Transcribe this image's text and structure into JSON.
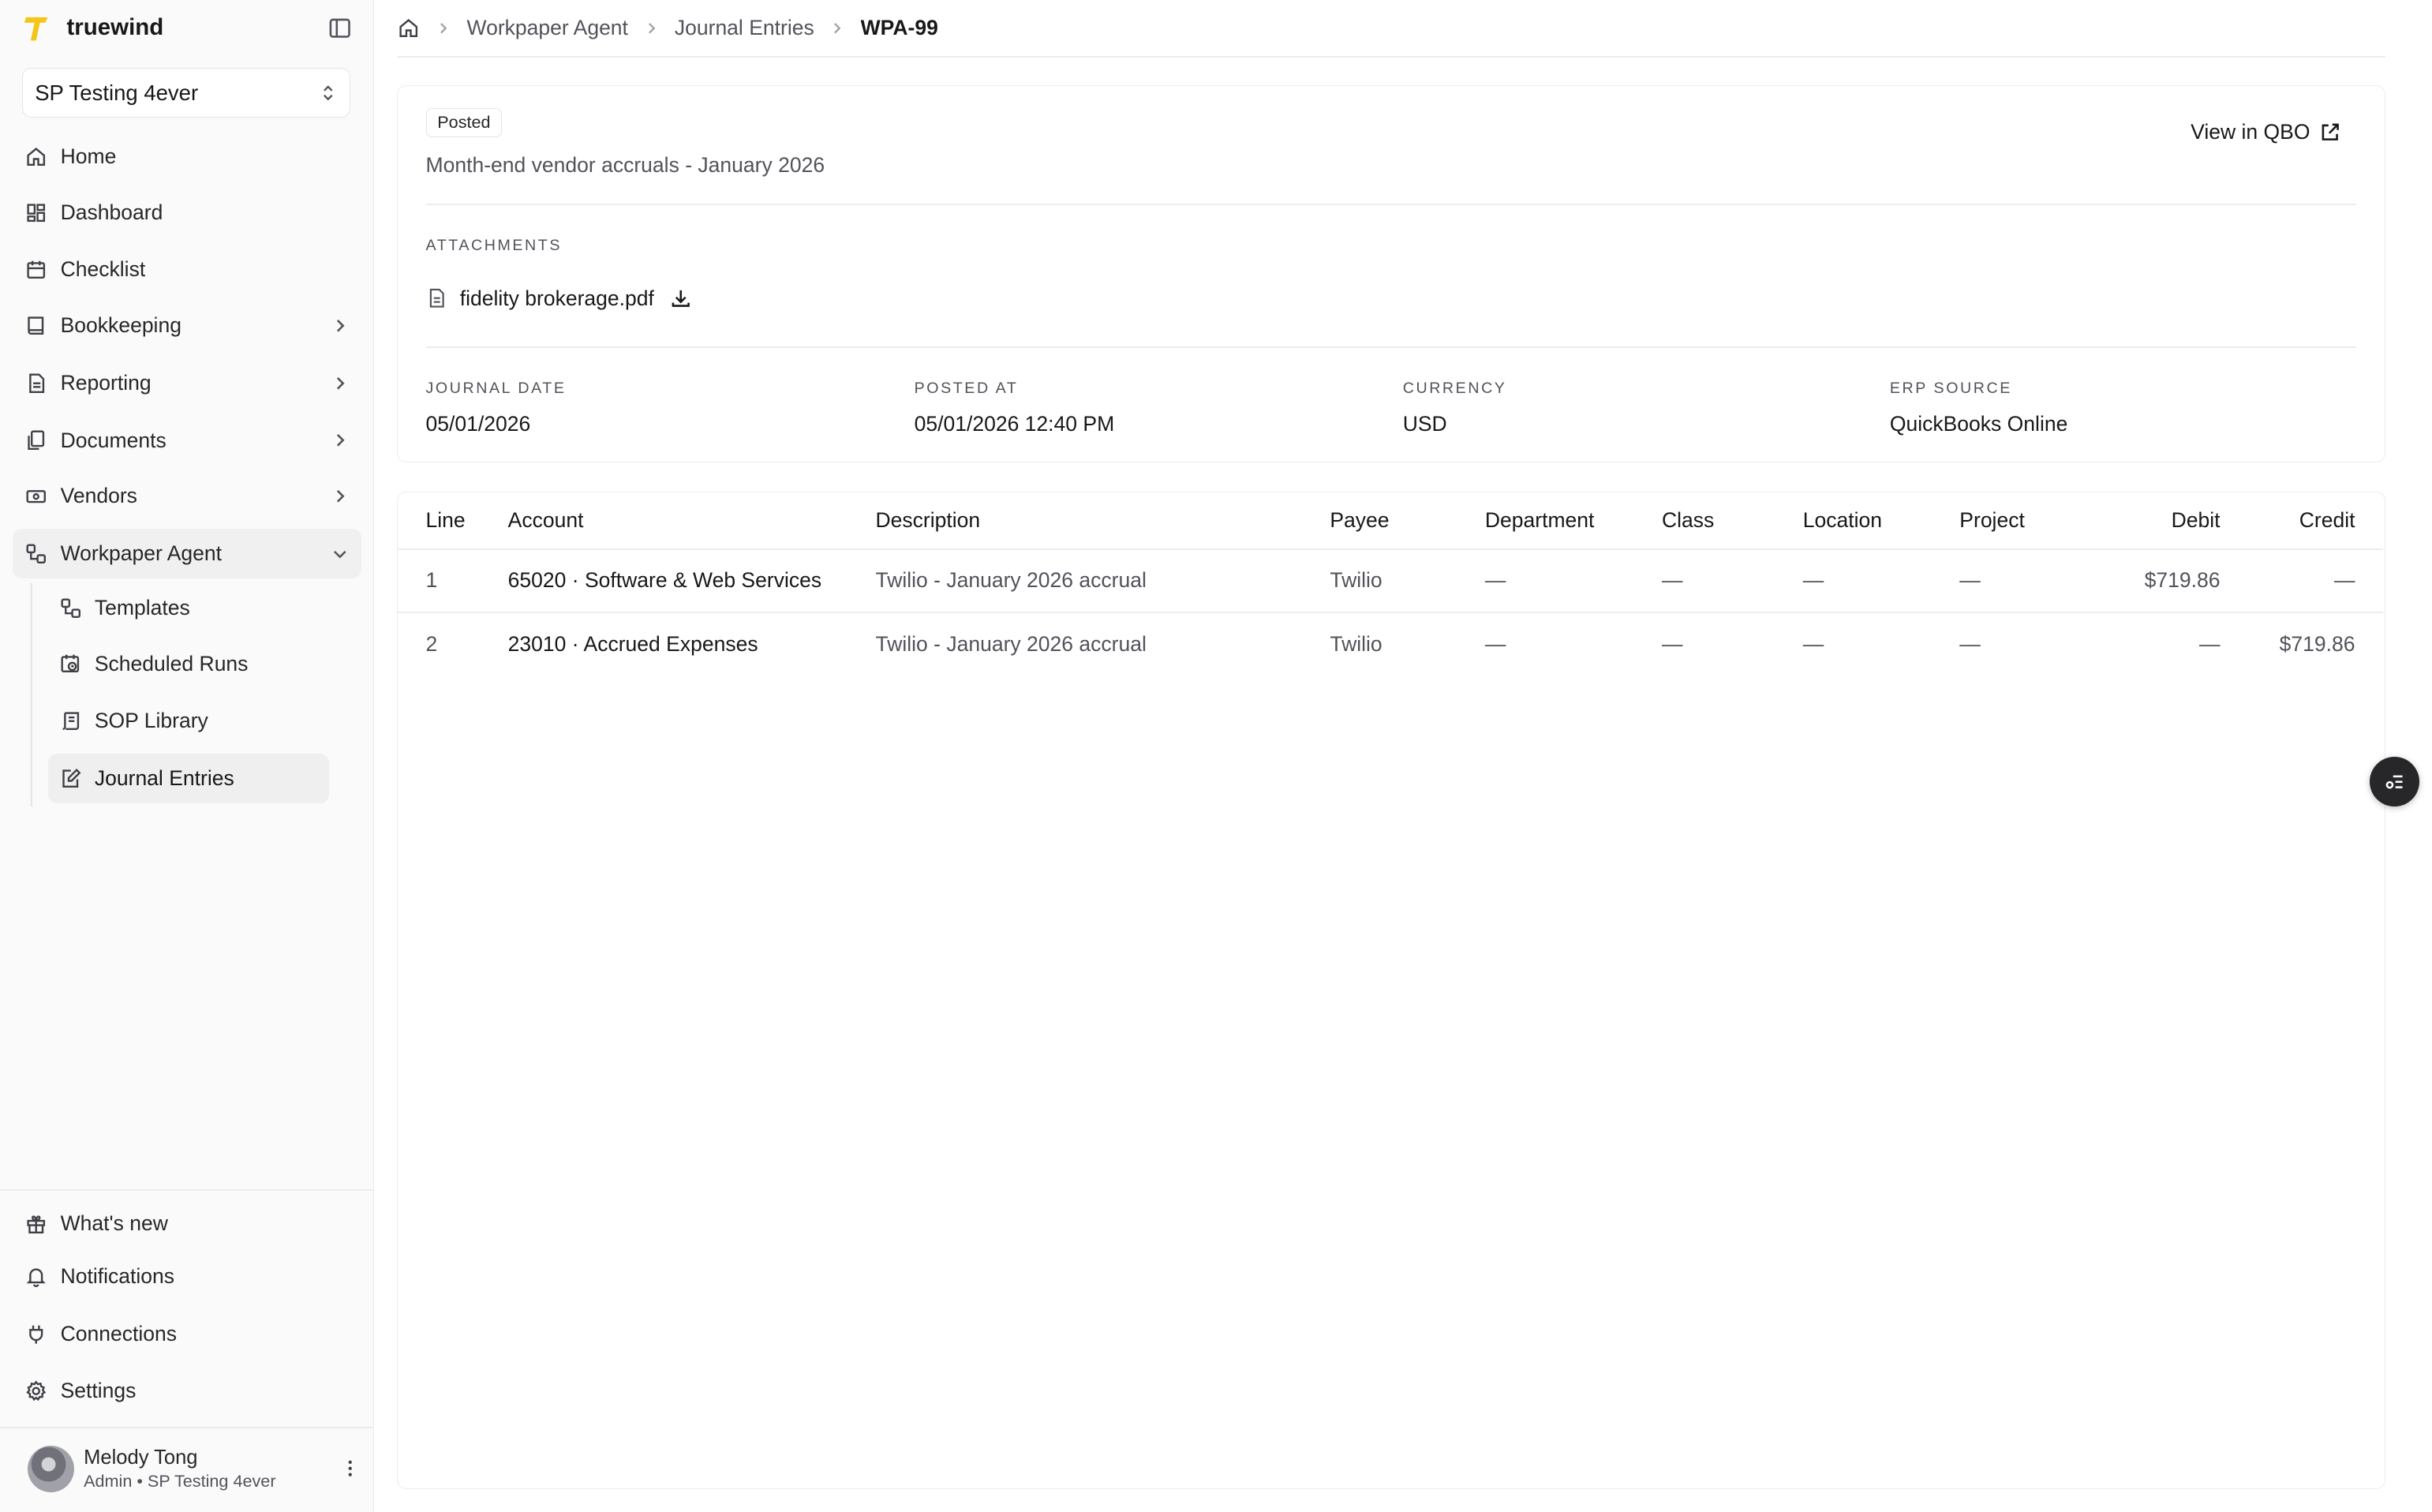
{
  "app": {
    "name": "truewind",
    "accent": "#f5c518"
  },
  "org": {
    "name": "SP Testing 4ever"
  },
  "nav": {
    "home": "Home",
    "dashboard": "Dashboard",
    "checklist": "Checklist",
    "bookkeeping": "Bookkeeping",
    "reporting": "Reporting",
    "documents": "Documents",
    "vendors": "Vendors",
    "workpaper_agent": "Workpaper Agent",
    "sub": {
      "templates": "Templates",
      "scheduled_runs": "Scheduled Runs",
      "sop_library": "SOP Library",
      "journal_entries": "Journal Entries"
    }
  },
  "footer_nav": {
    "whats_new": "What's new",
    "notifications": "Notifications",
    "connections": "Connections",
    "settings": "Settings"
  },
  "user": {
    "name": "Melody Tong",
    "role": "Admin • SP Testing 4ever"
  },
  "breadcrumb": {
    "b1": "Workpaper Agent",
    "b2": "Journal Entries",
    "current": "WPA-99"
  },
  "entry": {
    "status": "Posted",
    "memo": "Month-end vendor accruals - January 2026",
    "view_link": "View in QBO",
    "attachments_label": "ATTACHMENTS",
    "attachment_file": "fidelity brokerage.pdf",
    "meta": {
      "journal_date_label": "JOURNAL DATE",
      "journal_date": "05/01/2026",
      "posted_at_label": "POSTED AT",
      "posted_at": "05/01/2026 12:40 PM",
      "currency_label": "CURRENCY",
      "currency": "USD",
      "erp_source_label": "ERP SOURCE",
      "erp_source": "QuickBooks Online"
    }
  },
  "lines": {
    "headers": {
      "line": "Line",
      "account": "Account",
      "description": "Description",
      "payee": "Payee",
      "department": "Department",
      "class": "Class",
      "location": "Location",
      "project": "Project",
      "debit": "Debit",
      "credit": "Credit"
    },
    "rows": [
      {
        "line": "1",
        "account": "65020 · Software & Web Services",
        "description": "Twilio - January 2026 accrual",
        "payee": "Twilio",
        "department": "—",
        "class": "—",
        "location": "—",
        "project": "—",
        "debit": "$719.86",
        "credit": "—"
      },
      {
        "line": "2",
        "account": "23010 · Accrued Expenses",
        "description": "Twilio - January 2026 accrual",
        "payee": "Twilio",
        "department": "—",
        "class": "—",
        "location": "—",
        "project": "—",
        "debit": "—",
        "credit": "$719.86"
      }
    ]
  }
}
